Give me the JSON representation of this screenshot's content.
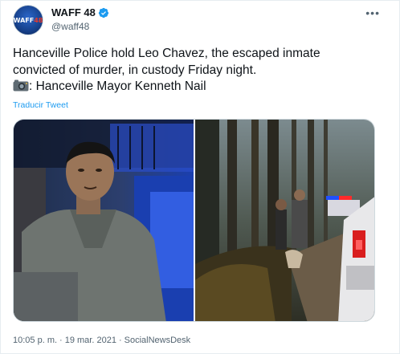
{
  "account": {
    "display_name": "WAFF 48",
    "handle": "@waff48",
    "avatar_text": "WAFF",
    "avatar_accent": "48",
    "brand_color": "#17418c",
    "verified": true
  },
  "tweet": {
    "line1": "Hanceville Police hold Leo Chavez, the escaped inmate",
    "line2": "convicted of murder, in custody Friday night.",
    "line3": ": Hanceville Mayor Kenneth Nail",
    "translate_label": "Traducir Tweet",
    "link_color": "#1d9bf0"
  },
  "meta": {
    "time": "10:05 p. m.",
    "separator": "·",
    "date": "19 mar. 2021",
    "source": "SocialNewsDesk"
  },
  "icons": {
    "more": "more-options-icon",
    "verified": "verified-badge-icon",
    "camera": "camera-icon"
  }
}
